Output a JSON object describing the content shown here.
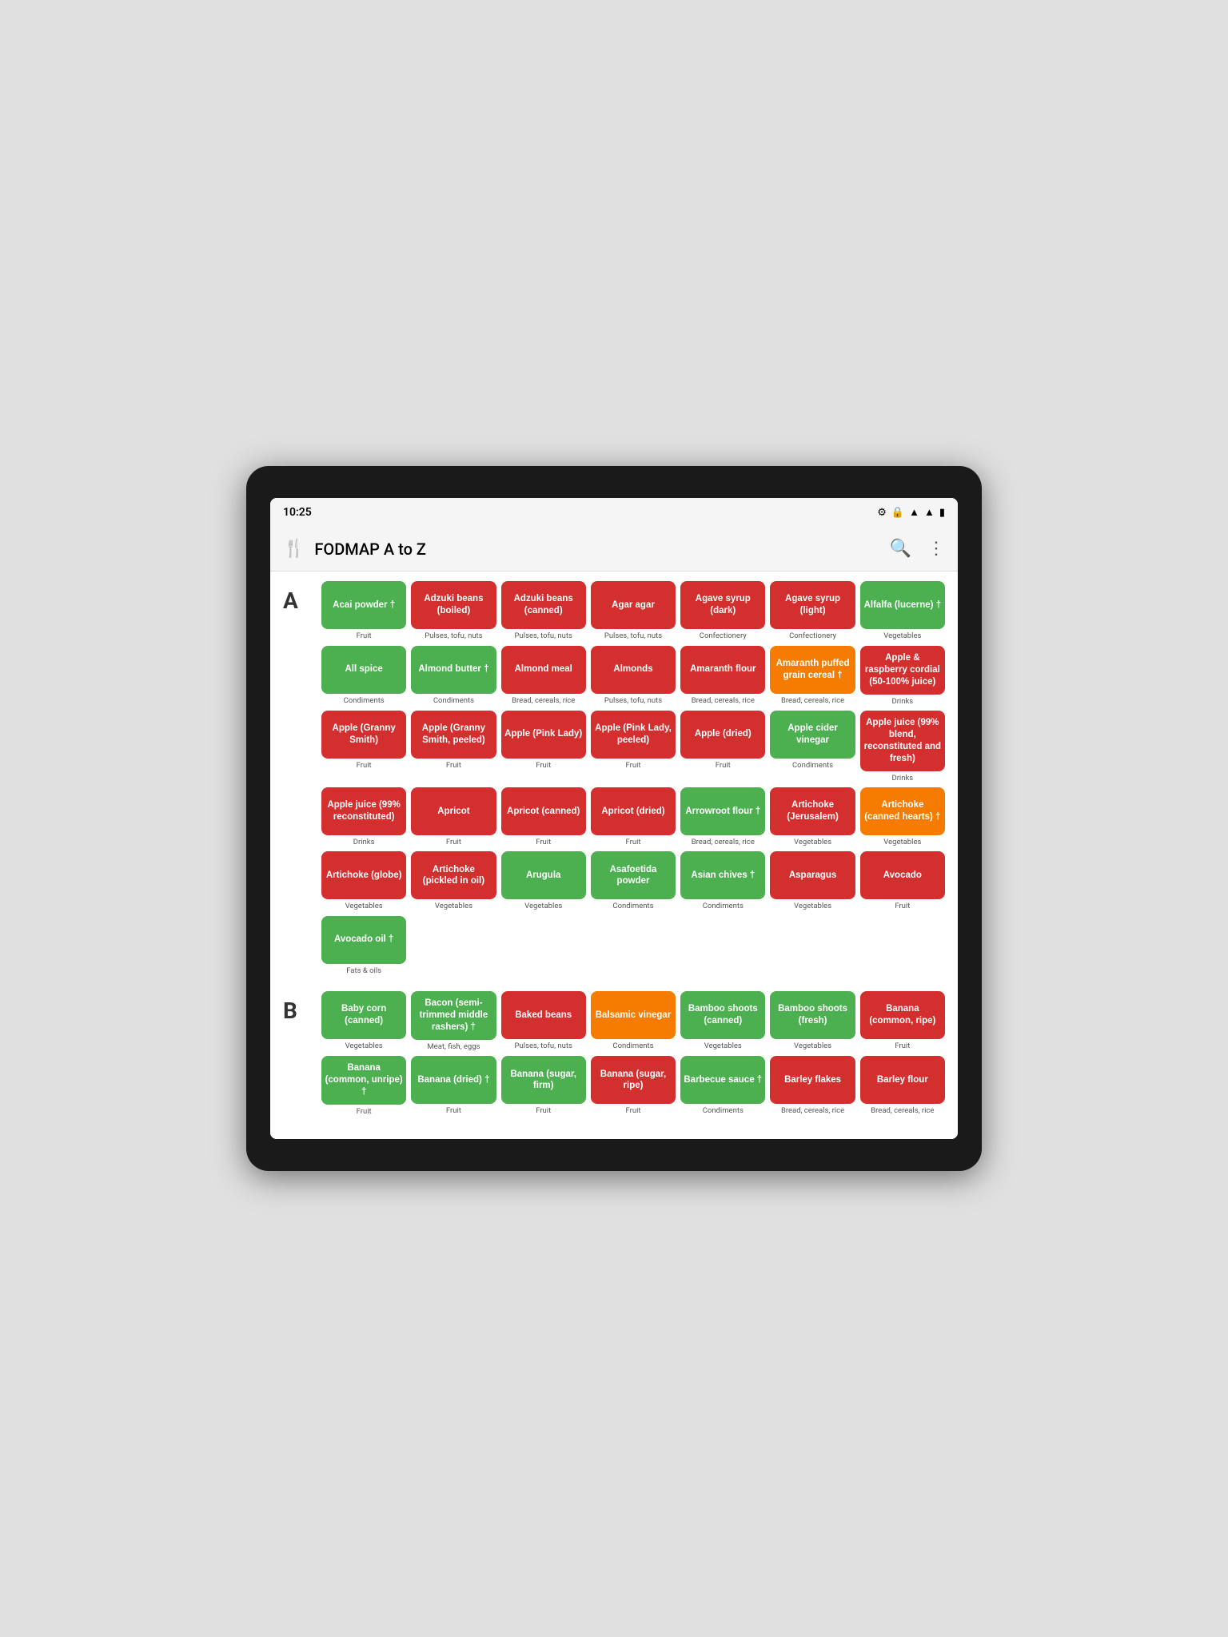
{
  "statusBar": {
    "time": "10:25",
    "icons": [
      "⚙",
      "🔒",
      "▾",
      "▾",
      "🔋"
    ]
  },
  "toolbar": {
    "icon": "🍴",
    "title": "FODMAP A to Z",
    "search": "🔍",
    "more": "⋮"
  },
  "sections": [
    {
      "letter": "A",
      "items": [
        {
          "label": "Acai powder †",
          "color": "green",
          "category": "Fruit"
        },
        {
          "label": "Adzuki beans (boiled)",
          "color": "red",
          "category": "Pulses, tofu, nuts"
        },
        {
          "label": "Adzuki beans (canned)",
          "color": "red",
          "category": "Pulses, tofu, nuts"
        },
        {
          "label": "Agar agar",
          "color": "red",
          "category": "Pulses, tofu, nuts"
        },
        {
          "label": "Agave syrup (dark)",
          "color": "red",
          "category": "Confectionery"
        },
        {
          "label": "Agave syrup (light)",
          "color": "red",
          "category": "Confectionery"
        },
        {
          "label": "Alfalfa (lucerne) †",
          "color": "green",
          "category": "Vegetables"
        },
        {
          "label": "All spice",
          "color": "green",
          "category": "Condiments"
        },
        {
          "label": "Almond butter †",
          "color": "green",
          "category": "Condiments"
        },
        {
          "label": "Almond meal",
          "color": "red",
          "category": "Bread, cereals, rice"
        },
        {
          "label": "Almonds",
          "color": "red",
          "category": "Pulses, tofu, nuts"
        },
        {
          "label": "Amaranth flour",
          "color": "red",
          "category": "Bread, cereals, rice"
        },
        {
          "label": "Amaranth puffed grain cereal †",
          "color": "orange",
          "category": "Bread, cereals, rice"
        },
        {
          "label": "Apple & raspberry cordial (50-100% juice)",
          "color": "red",
          "category": "Drinks"
        },
        {
          "label": "Apple (Granny Smith)",
          "color": "red",
          "category": "Fruit"
        },
        {
          "label": "Apple (Granny Smith, peeled)",
          "color": "red",
          "category": "Fruit"
        },
        {
          "label": "Apple (Pink Lady)",
          "color": "red",
          "category": "Fruit"
        },
        {
          "label": "Apple (Pink Lady, peeled)",
          "color": "red",
          "category": "Fruit"
        },
        {
          "label": "Apple (dried)",
          "color": "red",
          "category": "Fruit"
        },
        {
          "label": "Apple cider vinegar",
          "color": "green",
          "category": "Condiments"
        },
        {
          "label": "Apple juice (99% blend, reconstituted and fresh)",
          "color": "red",
          "category": "Drinks"
        },
        {
          "label": "Apple juice (99% reconstituted)",
          "color": "red",
          "category": "Drinks"
        },
        {
          "label": "Apricot",
          "color": "red",
          "category": "Fruit"
        },
        {
          "label": "Apricot (canned)",
          "color": "red",
          "category": "Fruit"
        },
        {
          "label": "Apricot (dried)",
          "color": "red",
          "category": "Fruit"
        },
        {
          "label": "Arrowroot flour †",
          "color": "green",
          "category": "Bread, cereals, rice"
        },
        {
          "label": "Artichoke (Jerusalem)",
          "color": "red",
          "category": "Vegetables"
        },
        {
          "label": "Artichoke (canned hearts) †",
          "color": "orange",
          "category": "Vegetables"
        },
        {
          "label": "Artichoke (globe)",
          "color": "red",
          "category": "Vegetables"
        },
        {
          "label": "Artichoke (pickled in oil)",
          "color": "red",
          "category": "Vegetables"
        },
        {
          "label": "Arugula",
          "color": "green",
          "category": "Vegetables"
        },
        {
          "label": "Asafoetida powder",
          "color": "green",
          "category": "Condiments"
        },
        {
          "label": "Asian chives †",
          "color": "green",
          "category": "Condiments"
        },
        {
          "label": "Asparagus",
          "color": "red",
          "category": "Vegetables"
        },
        {
          "label": "Avocado",
          "color": "red",
          "category": "Fruit"
        },
        {
          "label": "Avocado oil †",
          "color": "green",
          "category": "Fats & oils"
        },
        {
          "label": "",
          "color": "",
          "category": ""
        },
        {
          "label": "",
          "color": "",
          "category": ""
        },
        {
          "label": "",
          "color": "",
          "category": ""
        },
        {
          "label": "",
          "color": "",
          "category": ""
        },
        {
          "label": "",
          "color": "",
          "category": ""
        },
        {
          "label": "",
          "color": "",
          "category": ""
        }
      ]
    },
    {
      "letter": "B",
      "items": [
        {
          "label": "Baby corn (canned)",
          "color": "green",
          "category": "Vegetables"
        },
        {
          "label": "Bacon (semi-trimmed middle rashers) †",
          "color": "green",
          "category": "Meat, fish, eggs"
        },
        {
          "label": "Baked beans",
          "color": "red",
          "category": "Pulses, tofu, nuts"
        },
        {
          "label": "Balsamic vinegar",
          "color": "orange",
          "category": "Condiments"
        },
        {
          "label": "Bamboo shoots (canned)",
          "color": "green",
          "category": "Vegetables"
        },
        {
          "label": "Bamboo shoots (fresh)",
          "color": "green",
          "category": "Vegetables"
        },
        {
          "label": "Banana (common, ripe)",
          "color": "red",
          "category": "Fruit"
        },
        {
          "label": "Banana (common, unripe) †",
          "color": "green",
          "category": "Fruit"
        },
        {
          "label": "Banana (dried) †",
          "color": "green",
          "category": "Fruit"
        },
        {
          "label": "Banana (sugar, firm)",
          "color": "green",
          "category": "Fruit"
        },
        {
          "label": "Banana (sugar, ripe)",
          "color": "red",
          "category": "Fruit"
        },
        {
          "label": "Barbecue sauce †",
          "color": "green",
          "category": "Condiments"
        },
        {
          "label": "Barley flakes",
          "color": "red",
          "category": "Bread, cereals, rice"
        },
        {
          "label": "Barley flour",
          "color": "red",
          "category": "Bread, cereals, rice"
        }
      ]
    }
  ]
}
